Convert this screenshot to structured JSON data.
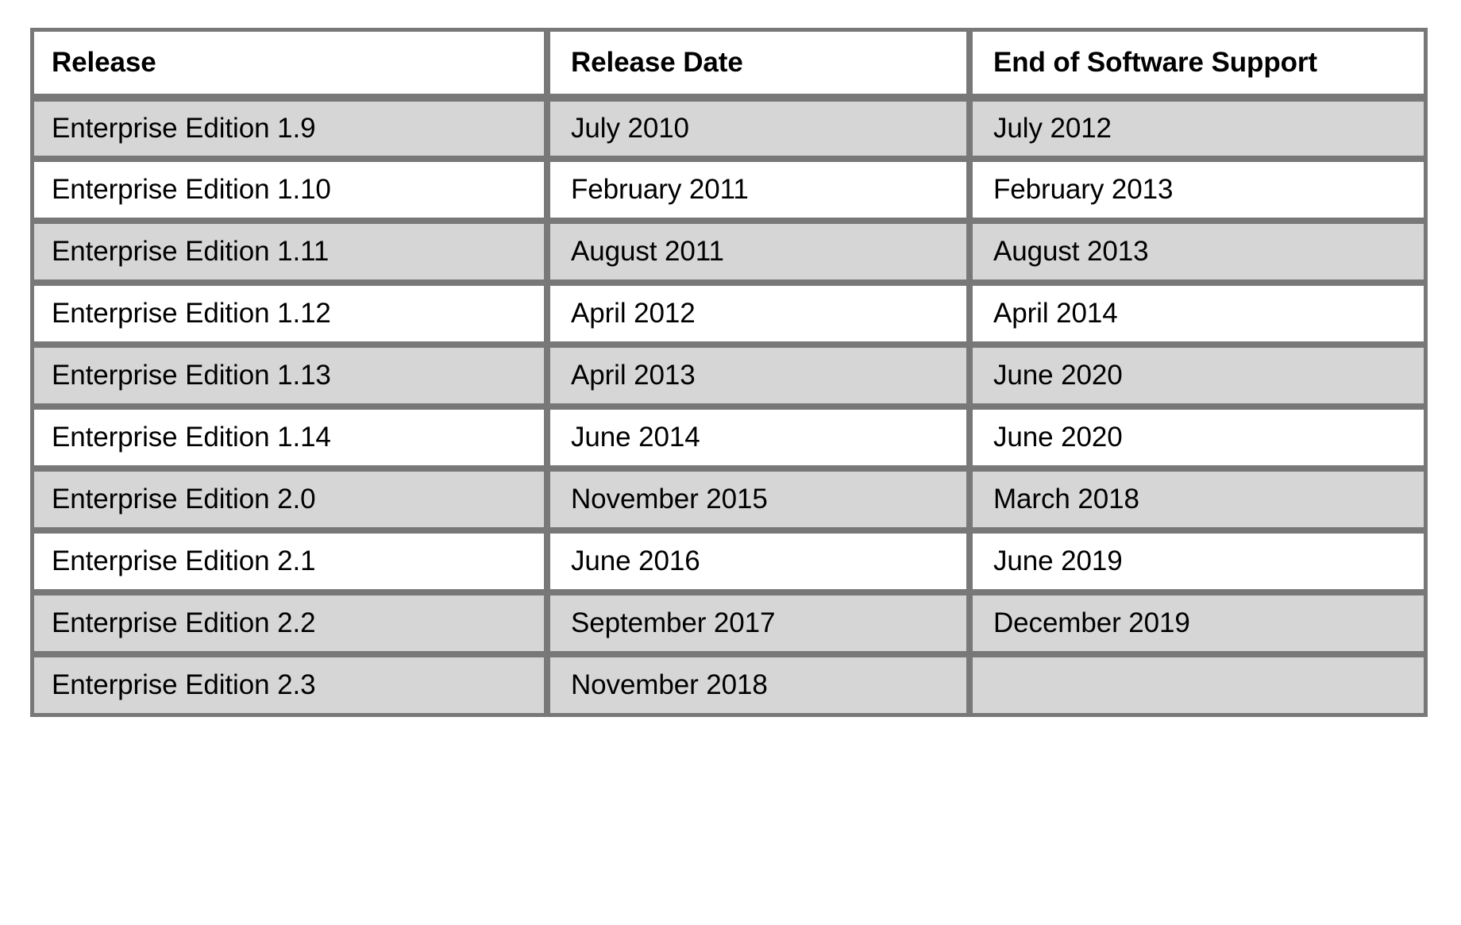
{
  "table": {
    "columns": [
      {
        "key": "release",
        "label": "Release"
      },
      {
        "key": "release_date",
        "label": "Release Date"
      },
      {
        "key": "end_of_support",
        "label": "End of Software Support"
      }
    ],
    "rows": [
      {
        "release": "Enterprise Edition 1.9",
        "release_date": "July 2010",
        "end_of_support": "July 2012",
        "shaded": true
      },
      {
        "release": "Enterprise Edition 1.10",
        "release_date": "February 2011",
        "end_of_support": "February 2013",
        "shaded": false
      },
      {
        "release": "Enterprise Edition 1.11",
        "release_date": "August 2011",
        "end_of_support": "August 2013",
        "shaded": true
      },
      {
        "release": "Enterprise Edition 1.12",
        "release_date": "April 2012",
        "end_of_support": "April 2014",
        "shaded": false
      },
      {
        "release": "Enterprise Edition 1.13",
        "release_date": "April 2013",
        "end_of_support": "June 2020",
        "shaded": true
      },
      {
        "release": "Enterprise Edition 1.14",
        "release_date": "June 2014",
        "end_of_support": "June 2020",
        "shaded": false
      },
      {
        "release": "Enterprise Edition 2.0",
        "release_date": "November 2015",
        "end_of_support": "March 2018",
        "shaded": true
      },
      {
        "release": "Enterprise Edition 2.1",
        "release_date": "June 2016",
        "end_of_support": "June 2019",
        "shaded": false
      },
      {
        "release": "Enterprise Edition 2.2",
        "release_date": "September 2017",
        "end_of_support": "December 2019",
        "shaded": true
      },
      {
        "release": "Enterprise Edition 2.3",
        "release_date": "November 2018",
        "end_of_support": "",
        "shaded": true
      }
    ]
  },
  "colors": {
    "border": "#787878",
    "shaded_row": "#d6d6d6",
    "plain_row": "#ffffff",
    "text": "#000000",
    "page_background": "#ffffff"
  }
}
